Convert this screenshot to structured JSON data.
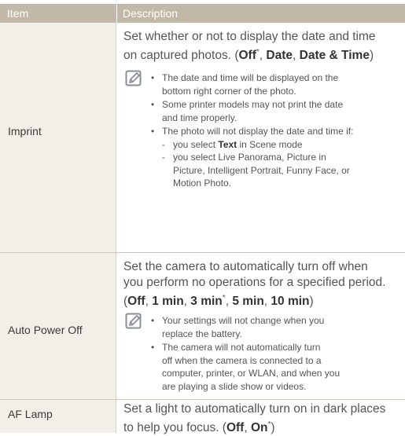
{
  "header": {
    "item": "Item",
    "description": "Description"
  },
  "imprint": {
    "label": "Imprint",
    "desc_line1": "Set whether or not to display the date and time",
    "desc_line2_pre": "on captured photos. (",
    "opt_off": "Off",
    "star": "*",
    "sep": ", ",
    "opt_date": "Date",
    "opt_datetime": "Date & Time",
    "close": ")",
    "note1_l1": "The date and time will be displayed on the",
    "note1_l2": "bottom right corner of the photo.",
    "note2_l1": "Some printer models may not print the date",
    "note2_l2": "and time properly.",
    "note3_l1": "The photo will not display the date and time if:",
    "sub1_pre": "you select ",
    "sub1_bold": "Text",
    "sub1_post": " in Scene mode",
    "sub2_l1": "you select Live Panorama, Picture in",
    "sub2_l2": "Picture, Intelligent Portrait, Funny Face, or",
    "sub2_l3": "Motion Photo."
  },
  "power": {
    "label": "Auto Power Off",
    "desc_line1": "Set the camera to automatically turn off when",
    "desc_line2": "you perform no operations for a specified period.",
    "open": "(",
    "opt_off": "Off",
    "opt_1": "1 min",
    "opt_3": "3 min",
    "opt_5": "5 min",
    "opt_10": "10 min",
    "star": "*",
    "sep": ", ",
    "close": ")",
    "note1_l1": "Your settings will not change when you",
    "note1_l2": "replace the battery.",
    "note2_l1": "The camera will not automatically turn",
    "note2_l2": "off when the camera is connected to a",
    "note2_l3": "computer, printer, or WLAN, and when you",
    "note2_l4": "are playing a slide show or videos."
  },
  "aflamp": {
    "label": "AF Lamp",
    "desc_line1": "Set a light to automatically turn on in dark places",
    "desc_line2_pre": "to help you focus. (",
    "opt_off": "Off",
    "sep": ", ",
    "opt_on": "On",
    "star": "*",
    "close": ")"
  },
  "icons": {
    "note": "note-pencil-icon",
    "bullet": "•",
    "dash": "-"
  },
  "colors": {
    "header_bg": "#c2b8a8",
    "item_bg": "#f2efe9",
    "icon": "#8a8f96"
  }
}
